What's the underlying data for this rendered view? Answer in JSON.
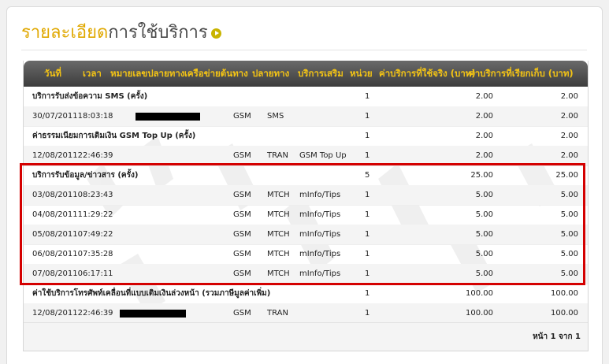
{
  "title": {
    "part1": "รายละเอียด",
    "part2": "การใช้บริการ"
  },
  "columns": {
    "date": "วันที่",
    "time": "เวลา",
    "dest_number": "หมายเลขปลายทาง",
    "origin_network": "เครือข่ายต้นทาง",
    "dest_network": "ปลายทาง",
    "extra_service": "บริการเสริม",
    "unit": "หน่วย",
    "actual_charge": "ค่าบริการที่ใช้จริง (บาท)",
    "billed_charge": "ค่าบริการที่เรียกเก็บ (บาท)"
  },
  "rows": [
    {
      "type": "section",
      "desc": "บริการรับส่งข้อความ SMS (ครั้ง)",
      "qty": "1",
      "actual": "2.00",
      "billed": "2.00"
    },
    {
      "type": "item",
      "datetime": "30/07/201118:03:18",
      "network": "GSM",
      "dtype": "SMS",
      "service": "",
      "qty": "1",
      "actual": "2.00",
      "billed": "2.00",
      "redacted": true
    },
    {
      "type": "section",
      "desc": "ค่าธรรมเนียมการเติมเงิน GSM Top Up (ครั้ง)",
      "qty": "1",
      "actual": "2.00",
      "billed": "2.00"
    },
    {
      "type": "item",
      "datetime": "12/08/201122:46:39",
      "network": "GSM",
      "dtype": "TRAN",
      "service": "GSM Top Up",
      "qty": "1",
      "actual": "2.00",
      "billed": "2.00"
    },
    {
      "type": "section",
      "desc": "บริการรับข้อมูล/ข่าวสาร (ครั้ง)",
      "qty": "5",
      "actual": "25.00",
      "billed": "25.00"
    },
    {
      "type": "item",
      "datetime": "03/08/201108:23:43",
      "network": "GSM",
      "dtype": "MTCH",
      "service": "mInfo/Tips",
      "qty": "1",
      "actual": "5.00",
      "billed": "5.00"
    },
    {
      "type": "item",
      "datetime": "04/08/201111:29:22",
      "network": "GSM",
      "dtype": "MTCH",
      "service": "mInfo/Tips",
      "qty": "1",
      "actual": "5.00",
      "billed": "5.00"
    },
    {
      "type": "item",
      "datetime": "05/08/201107:49:22",
      "network": "GSM",
      "dtype": "MTCH",
      "service": "mInfo/Tips",
      "qty": "1",
      "actual": "5.00",
      "billed": "5.00"
    },
    {
      "type": "item",
      "datetime": "06/08/201107:35:28",
      "network": "GSM",
      "dtype": "MTCH",
      "service": "mInfo/Tips",
      "qty": "1",
      "actual": "5.00",
      "billed": "5.00"
    },
    {
      "type": "item",
      "datetime": "07/08/201106:17:11",
      "network": "GSM",
      "dtype": "MTCH",
      "service": "mInfo/Tips",
      "qty": "1",
      "actual": "5.00",
      "billed": "5.00"
    },
    {
      "type": "section",
      "desc": "ค่าใช้บริการโทรศัพท์เคลื่อนที่แบบเติมเงินล่วงหน้า (รวมภาษีมูลค่าเพิ่ม)",
      "qty": "1",
      "actual": "100.00",
      "billed": "100.00"
    },
    {
      "type": "item",
      "datetime": "12/08/201122:46:39",
      "network": "GSM",
      "dtype": "TRAN",
      "service": "",
      "qty": "1",
      "actual": "100.00",
      "billed": "100.00",
      "redacted": true
    }
  ],
  "pager": "หน้า 1 จาก 1",
  "colors": {
    "accent": "#f4c414",
    "highlight": "#d40000",
    "title_accent": "#e0a800"
  }
}
